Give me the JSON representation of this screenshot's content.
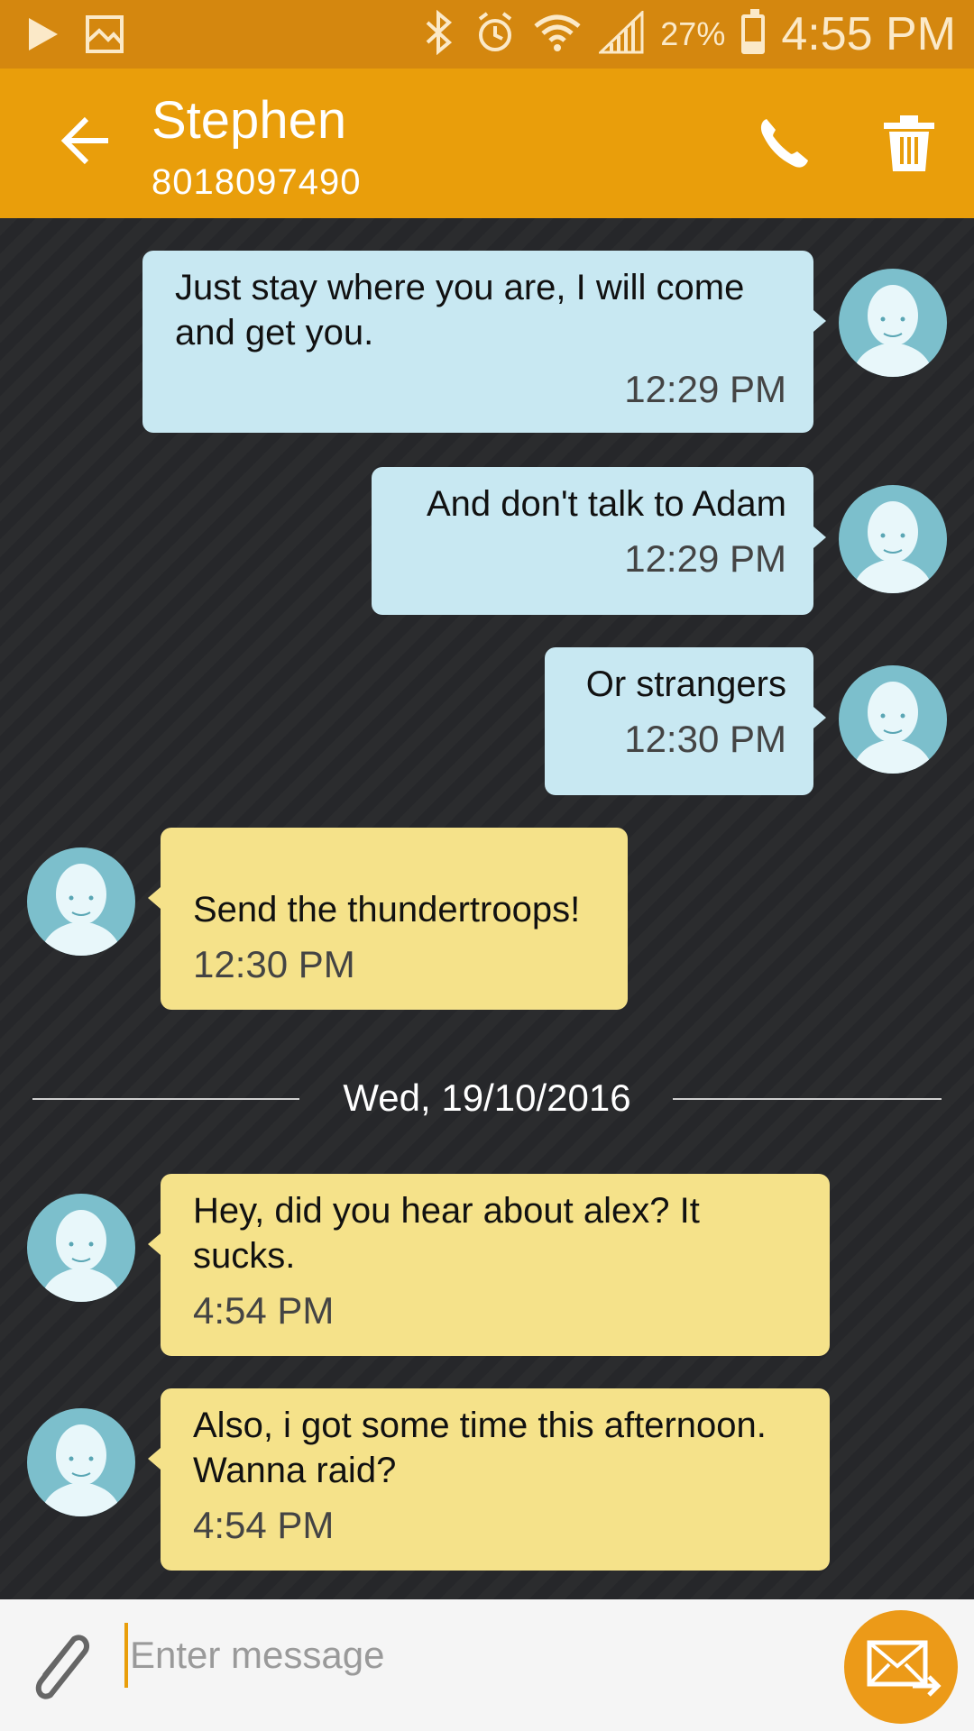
{
  "status_bar": {
    "battery_pct": "27%",
    "battery_level": 0.27,
    "time": "4:55 PM",
    "icons": [
      "play-store-icon",
      "gallery-icon",
      "bluetooth-icon",
      "alarm-icon",
      "wifi-icon",
      "signal-icon",
      "battery-icon"
    ]
  },
  "header": {
    "contact_name": "Stephen",
    "contact_number": "8018097490",
    "icons": [
      "back-arrow-icon",
      "phone-icon",
      "trash-icon"
    ]
  },
  "messages": [
    {
      "direction": "outgoing",
      "text": "Just stay where you are, I will come and get you.",
      "time": "12:29 PM"
    },
    {
      "direction": "outgoing",
      "text": "And don't talk to Adam",
      "time": "12:29 PM"
    },
    {
      "direction": "outgoing",
      "text": "Or strangers",
      "time": "12:30 PM"
    },
    {
      "direction": "incoming",
      "text": "Send the thundertroops!",
      "time": "12:30 PM"
    },
    {
      "direction": "incoming",
      "text": "Hey, did you hear about alex? It sucks.",
      "time": "4:54 PM"
    },
    {
      "direction": "incoming",
      "text": "Also, i got some time this afternoon. Wanna raid?",
      "time": "4:54 PM"
    }
  ],
  "date_separator": "Wed, 19/10/2016",
  "compose": {
    "placeholder": "Enter message",
    "value": "",
    "icons": [
      "paperclip-icon",
      "send-icon"
    ]
  },
  "colors": {
    "status_bar": "#d4870f",
    "app_bar": "#e99e0b",
    "outgoing_bubble": "#c8e8f2",
    "incoming_bubble": "#f5e28a",
    "send_button": "#ec9a18"
  }
}
